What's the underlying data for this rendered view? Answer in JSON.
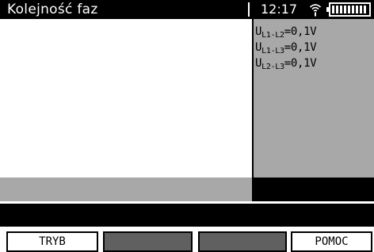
{
  "header": {
    "title": "Kolejność faz",
    "time": "12:17",
    "signal_icon": "wireless-signal-icon",
    "battery_icon": "battery-full-icon"
  },
  "readings": [
    {
      "symbol": "U",
      "sub": "L1-L2",
      "value": "=0,1V"
    },
    {
      "symbol": "U",
      "sub": "L1-L3",
      "value": "=0,1V"
    },
    {
      "symbol": "U",
      "sub": "L2-L3",
      "value": "=0,1V"
    }
  ],
  "softkeys": {
    "f1": "TRYB",
    "f2": "",
    "f3": "",
    "f4": "POMOC"
  },
  "colors": {
    "header_bg": "#000000",
    "panel_gray": "#a8a8a8",
    "blank_key": "#606060"
  }
}
